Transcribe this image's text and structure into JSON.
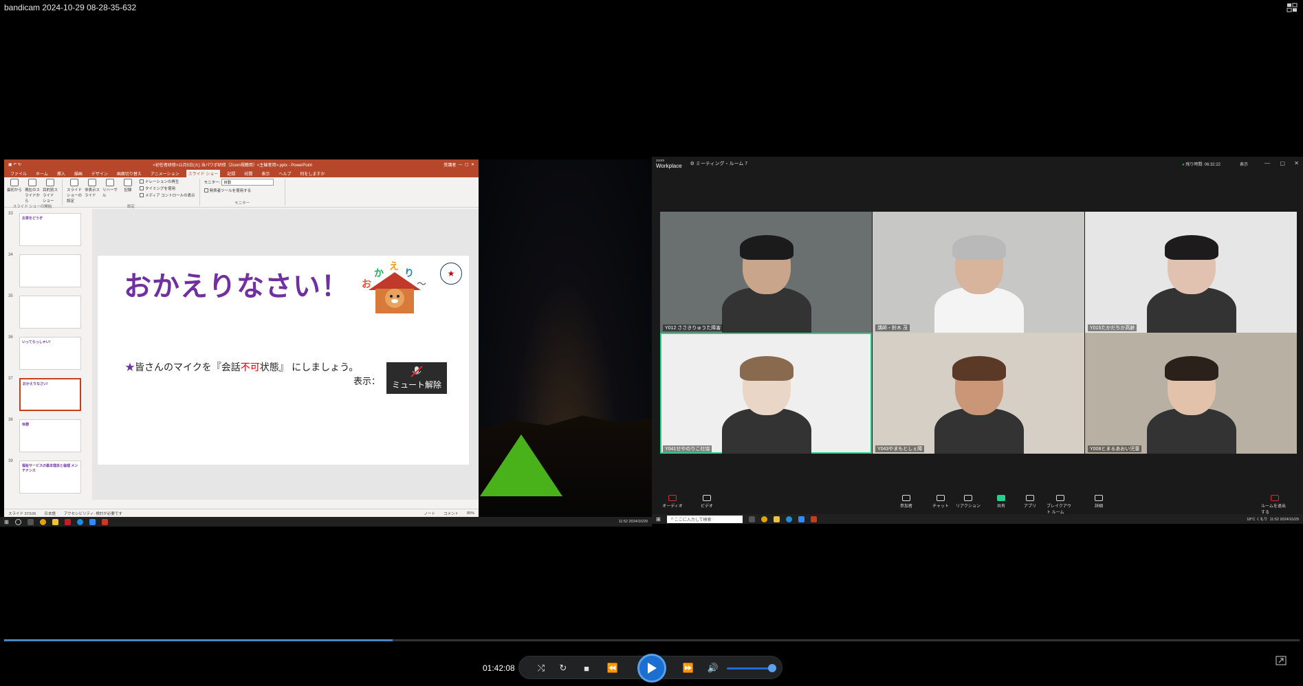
{
  "player": {
    "title": "bandicam 2024-10-29 08-28-35-632",
    "time": "01:42:08",
    "progress": 0.3,
    "volume": 0.85,
    "colors": {
      "accent": "#1a6fd0",
      "progress": "#4d84c4"
    }
  },
  "ppt": {
    "window_title": "<初任者研修>11月5日(火) 当パワポ研修（Zoom視聴用）<主催者用>.pptx - PowerPoint",
    "user": "受講者",
    "tabs": [
      "ファイル",
      "ホーム",
      "挿入",
      "描画",
      "デザイン",
      "画面切り替え",
      "アニメーション",
      "スライド ショー",
      "記録",
      "校閲",
      "表示",
      "ヘルプ",
      "何をしますか"
    ],
    "active_tab": "スライド ショー",
    "ribbon": {
      "start_group": [
        "最初から",
        "現在のスライドから",
        "目的別スライド ショー"
      ],
      "start_caption": "スライド ショーの開始",
      "setup_group": [
        "スライド ショーの設定",
        "非表示スライド",
        "リハーサル",
        "記録"
      ],
      "checkboxes": [
        "ナレーションの再生",
        "タイミングを使用",
        "メディア コントロールの表示"
      ],
      "setup_caption": "設定",
      "monitor_label": "モニター:",
      "monitor_value": "自動",
      "presenter_tool": "発表者ツールを使用する",
      "monitor_caption": "モニター"
    },
    "thumbnails": [
      {
        "num": "33",
        "text": "お茶をどうぞ"
      },
      {
        "num": "34",
        "text": ""
      },
      {
        "num": "35",
        "text": ""
      },
      {
        "num": "36",
        "text": "いってらっしゃい!"
      },
      {
        "num": "37",
        "text": "おかえりなさい!"
      },
      {
        "num": "38",
        "text": "休憩"
      },
      {
        "num": "39",
        "text": "福祉サービスの基本理念と倫理 メンテナンス"
      }
    ],
    "slide": {
      "title": "おかえりなさい！",
      "logo_text": "おかえり",
      "star": "★",
      "mic_star": "★",
      "mic_pre": "皆さんのマイクを『会話",
      "mic_red": "不可",
      "mic_post": "状態』 にしましょう。",
      "show_label": "表示：",
      "unmute_label": "ミュート解除"
    },
    "status": {
      "slide_pos": "スライド 37/106",
      "language": "日本語",
      "accessibility": "アクセシビリティ: 検討が必要です",
      "notes": "ノート",
      "comments": "コメント",
      "zoom": "85%"
    }
  },
  "zoom": {
    "logo": "zoom",
    "logo_sub": "Workplace",
    "room": "ミーティング・ルーム 7",
    "timer": "残り時間: 06:32:22",
    "view": "表示",
    "participants": [
      {
        "name": "Y012 ささきりゅうた障害",
        "skin": "#c8a58b",
        "bg": "#6a6f70",
        "hair": "#1b1b1b"
      },
      {
        "name": "講師・鈴木 茂",
        "skin": "#d8b49c",
        "bg": "#c7c7c5",
        "hair": "#b9b9b9"
      },
      {
        "name": "Y015たかだちか高齢",
        "skin": "#e1c2b0",
        "bg": "#e6e6e6",
        "hair": "#1d1b1b"
      },
      {
        "name": "Y041せやのりこ社協",
        "skin": "#e9d6c6",
        "bg": "#efefef",
        "hair": "#8a6a4e"
      },
      {
        "name": "Y043やまもとしぇ障",
        "skin": "#c99678",
        "bg": "#d5cfc5",
        "hair": "#5a3a26"
      },
      {
        "name": "Y008とまるあおい児童",
        "skin": "#e2c2aa",
        "bg": "#b8b1a3",
        "hair": "#2b211b"
      }
    ],
    "toolbar": [
      {
        "label": "オーディオ",
        "id": "audio"
      },
      {
        "label": "ビデオ",
        "id": "video"
      },
      {
        "label": "参加者",
        "id": "participants"
      },
      {
        "label": "チャット",
        "id": "chat"
      },
      {
        "label": "リアクション",
        "id": "reactions"
      },
      {
        "label": "共有",
        "id": "share"
      },
      {
        "label": "アプリ",
        "id": "apps"
      },
      {
        "label": "ブレイクアウト ルーム",
        "id": "breakout"
      },
      {
        "label": "詳細",
        "id": "more"
      },
      {
        "label": "ルームを退出する",
        "id": "leave"
      }
    ]
  },
  "taskbar": {
    "search_placeholder": "ここに入力して検索",
    "weather": "18°C くもり",
    "clock_time": "11:52",
    "clock_date": "2024/10/29",
    "left_clock_time": "11:52",
    "left_clock_date": "2024/10/29"
  }
}
